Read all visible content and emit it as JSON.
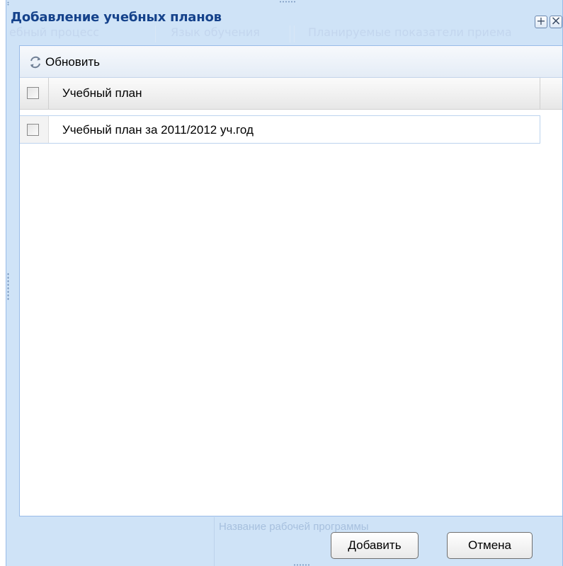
{
  "window": {
    "title": "Добавление учебных планов",
    "background_tabs": [
      "ебный процесс",
      "Язык обучения",
      "Планируемые показатели приема"
    ],
    "tools": {
      "expand": "+",
      "close": "×"
    },
    "background_field_label": "Название рабочей программы"
  },
  "toolbar": {
    "refresh_icon": "refresh-icon",
    "refresh_label": "Обновить"
  },
  "grid": {
    "columns": [
      "Учебный план"
    ],
    "rows": [
      {
        "checked": false,
        "name": "Учебный план за 2011/2012 уч.год"
      }
    ]
  },
  "buttons": {
    "add": "Добавить",
    "cancel": "Отмена"
  },
  "colors": {
    "title": "#15428b",
    "frame": "#cfe3f7",
    "border": "#99bbe8"
  }
}
